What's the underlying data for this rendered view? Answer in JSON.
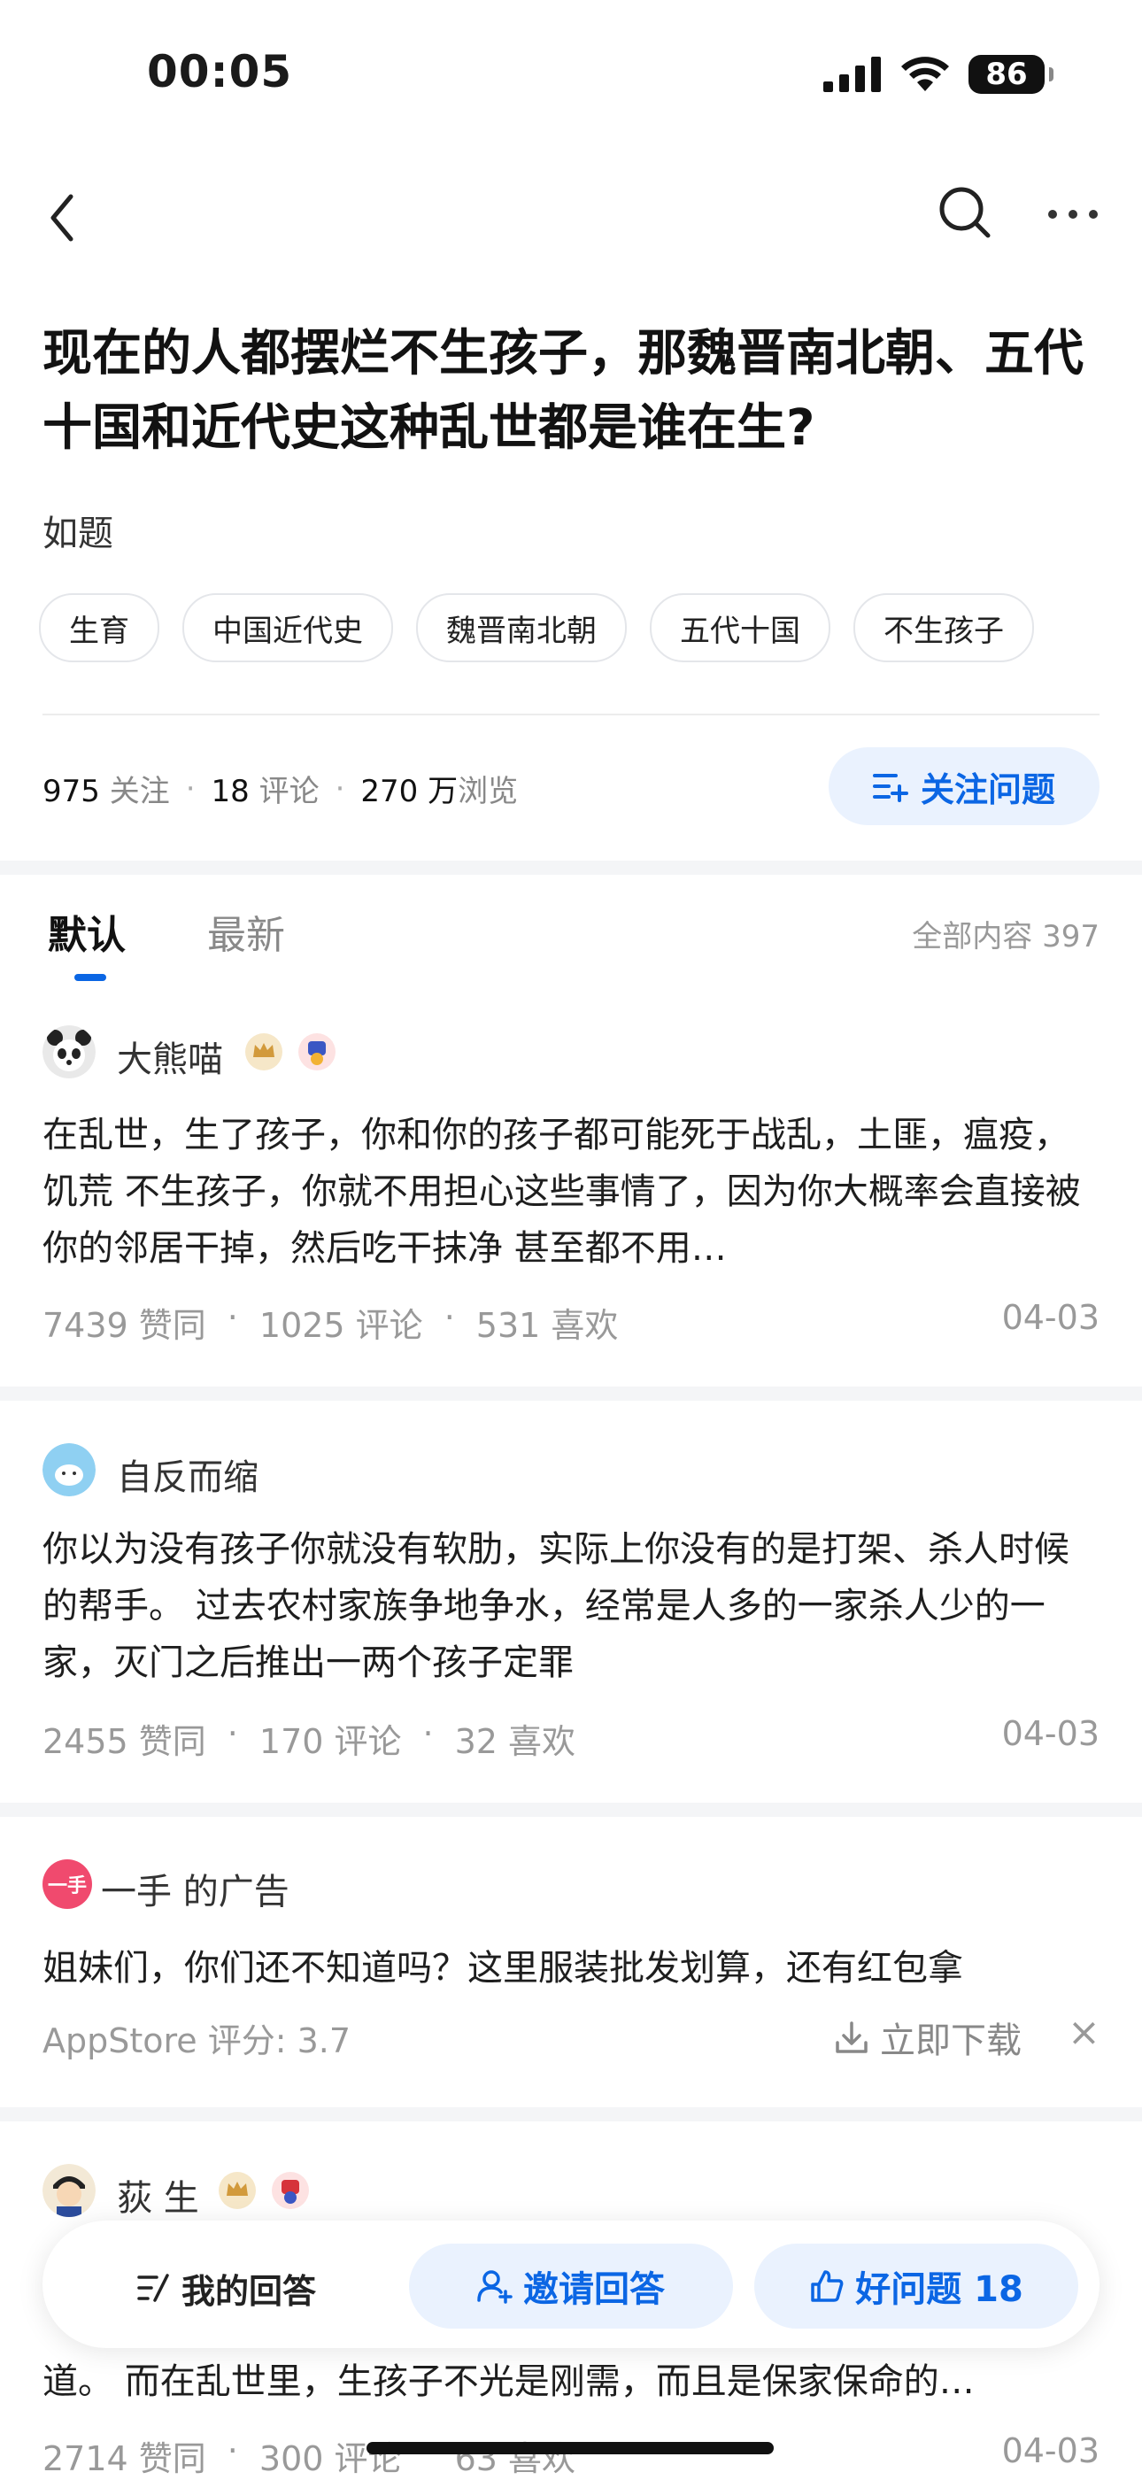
{
  "status": {
    "time": "00:05",
    "battery": "86"
  },
  "question": {
    "title": "现在的人都摆烂不生孩子，那魏晋南北朝、五代十国和近代史这种乱世都是谁在生?",
    "desc": "如题",
    "tags": [
      "生育",
      "中国近代史",
      "魏晋南北朝",
      "五代十国",
      "不生孩子"
    ],
    "followers": "975",
    "followers_label": "关注",
    "comments": "18",
    "comments_label": "评论",
    "views": "270 万",
    "views_label": "浏览",
    "follow_button": "关注问题"
  },
  "tabs": {
    "default": "默认",
    "latest": "最新",
    "all_count": "全部内容 397"
  },
  "answers": [
    {
      "author": "大熊喵",
      "text": "在乱世，生了孩子，你和你的孩子都可能死于战乱，土匪，瘟疫，饥荒 不生孩子，你就不用担心这些事情了，因为你大概率会直接被你的邻居干掉，然后吃干抹净 甚至都不用…",
      "likes": "7439 赞同",
      "comments": "1025 评论",
      "favs": "531 喜欢",
      "date": "04-03"
    },
    {
      "author": "自反而缩",
      "text": "你以为没有孩子你就没有软肋，实际上你没有的是打架、杀人时候的帮手。 过去农村家族争地争水，经常是人多的一家杀人少的一家，灭门之后推出一两个孩子定罪",
      "likes": "2455 赞同",
      "comments": "170 评论",
      "favs": "32 喜欢",
      "date": "04-03"
    },
    {
      "author": "荻 生",
      "text": "道。 而在乱世里，生孩子不光是刚需，而且是保家保命的…",
      "likes": "2714 赞同",
      "comments": "300 评论",
      "favs": "63 喜欢",
      "date": "04-03"
    }
  ],
  "ad": {
    "logo_text": "一手",
    "name": "一手 的广告",
    "text": "姐妹们，你们还不知道吗？这里服装批发划算，还有红包拿",
    "rating": "AppStore 评分: 3.7",
    "download": "立即下载"
  },
  "bottom_bar": {
    "my_answer": "我的回答",
    "invite": "邀请回答",
    "good_question": "好问题 18"
  },
  "colors": {
    "accent": "#0b66e4",
    "accent_bg": "#eaf2fe"
  }
}
